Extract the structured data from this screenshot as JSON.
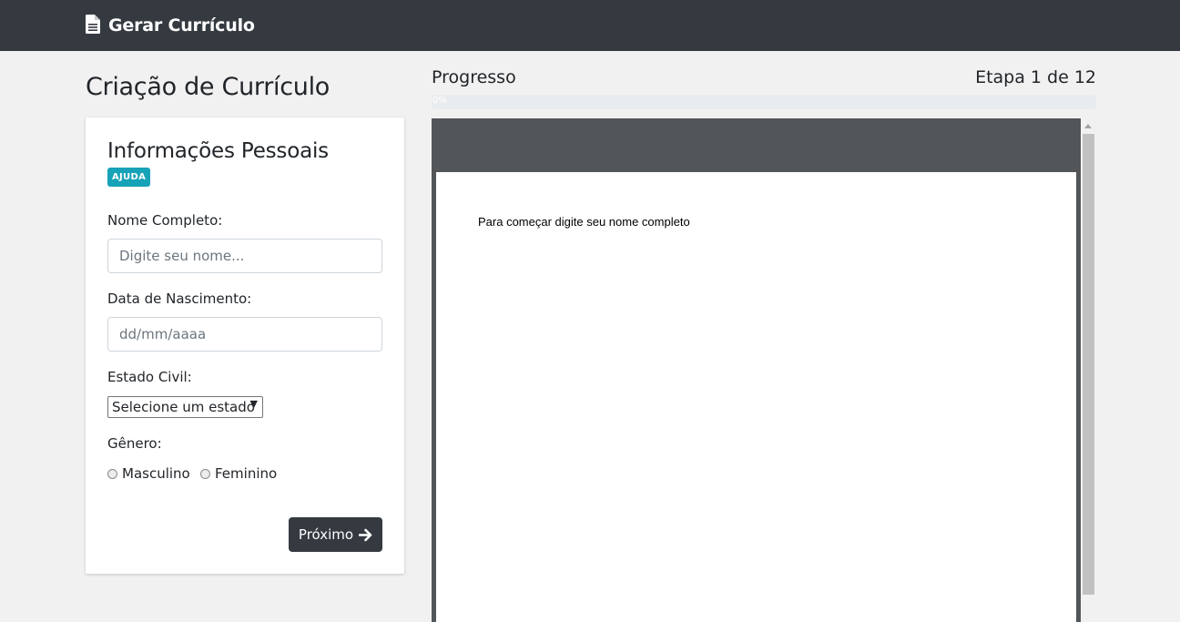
{
  "navbar": {
    "brand": "Gerar Currículo",
    "brand_icon": "file-text-icon"
  },
  "page": {
    "title": "Criação de Currículo"
  },
  "form": {
    "section_title": "Informações Pessoais",
    "help_badge": "AJUDA",
    "name_label": "Nome Completo:",
    "name_placeholder": "Digite seu nome...",
    "birth_label": "Data de Nascimento:",
    "birth_placeholder": "dd/mm/aaaa",
    "marital_label": "Estado Civil:",
    "marital_selected": "Selecione um estado",
    "gender_label": "Gênero:",
    "gender_options": [
      "Masculino",
      "Feminino"
    ],
    "next_button": "Próximo",
    "next_icon": "arrow-right-icon"
  },
  "progress": {
    "label": "Progresso",
    "step": "Etapa 1 de 12",
    "percent_text": "0%",
    "fraction": 0
  },
  "preview": {
    "text": "Para começar digite seu nome completo"
  },
  "colors": {
    "navbar": "#343a40",
    "badge": "#17a2b8",
    "button": "#343a40",
    "preview_frame": "#525659",
    "progress_fill": "#007bff"
  }
}
